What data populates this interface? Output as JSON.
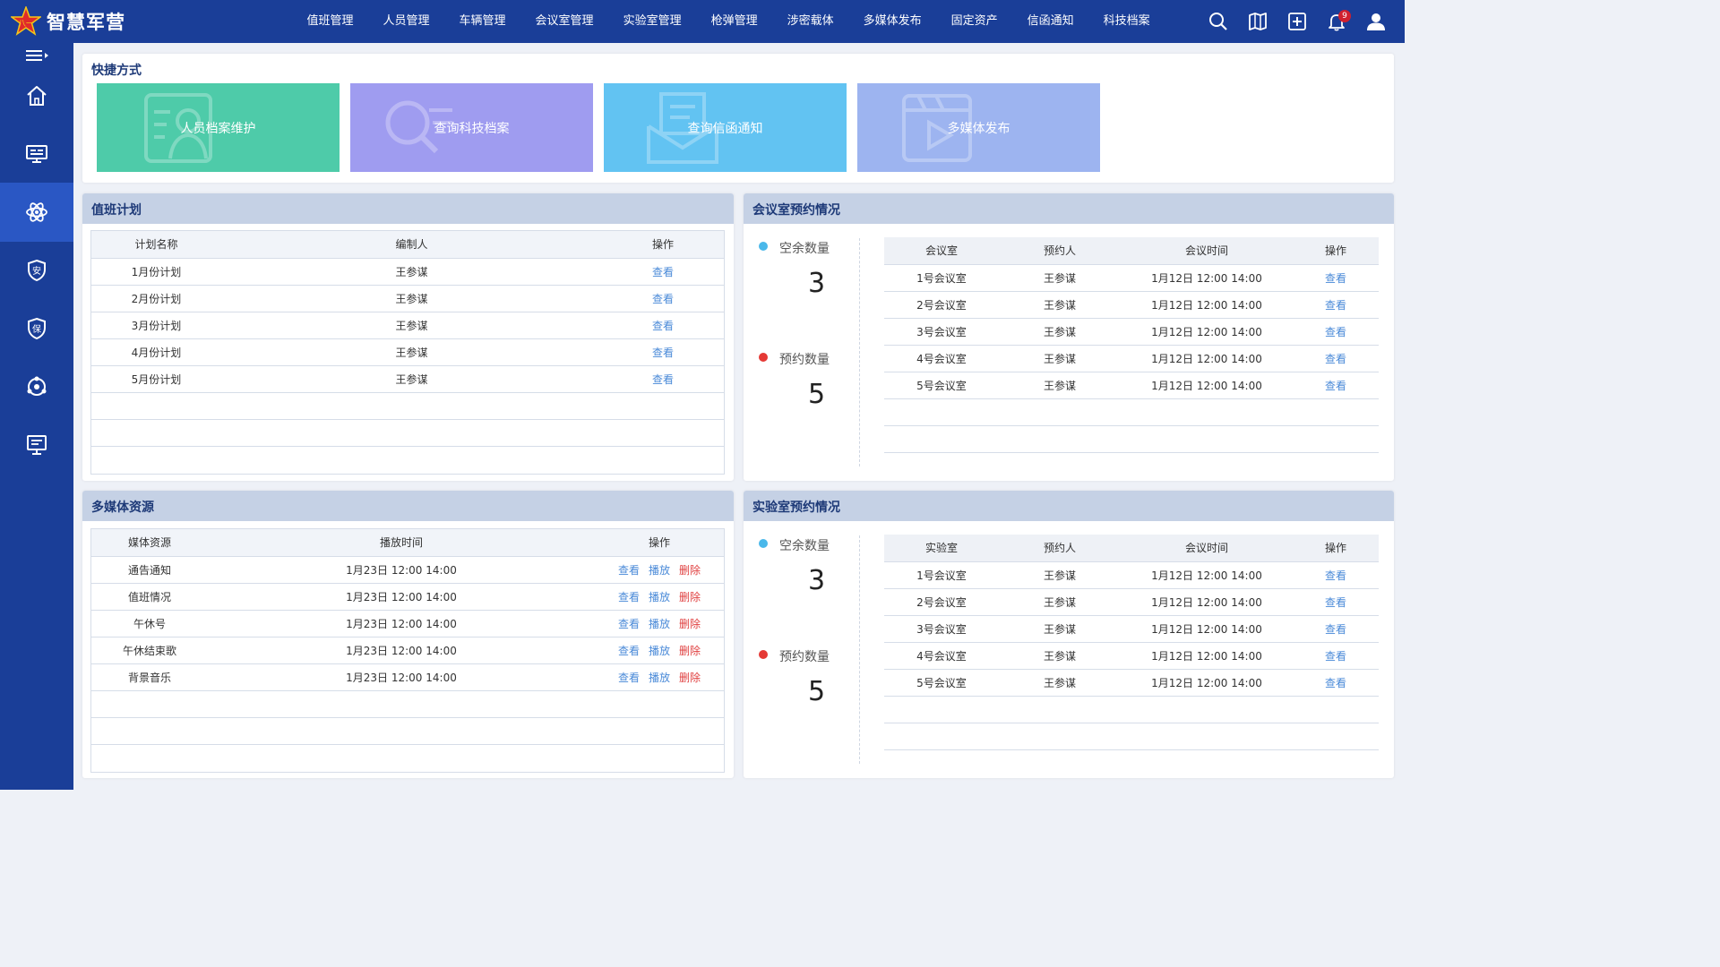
{
  "app": {
    "title": "智慧军营"
  },
  "nav": [
    "值班管理",
    "人员管理",
    "车辆管理",
    "会议室管理",
    "实验室管理",
    "枪弹管理",
    "涉密载体",
    "多媒体发布",
    "固定资产",
    "信函通知",
    "科技档案"
  ],
  "top_icons": {
    "search": "search-icon",
    "map": "map-icon",
    "add": "add-square-icon",
    "bell": "bell-icon",
    "user": "user-icon",
    "bell_badge": "9"
  },
  "sidebar": [
    "home-icon",
    "monitor-icon",
    "atom-icon",
    "shield-an-icon",
    "shield-bao-icon",
    "network-icon",
    "presentation-icon"
  ],
  "quick": {
    "title": "快捷方式",
    "tiles": [
      {
        "label": "人员档案维护",
        "color": "#4ecba9"
      },
      {
        "label": "查询科技档案",
        "color": "#9f9cf0"
      },
      {
        "label": "查询信函通知",
        "color": "#62c3f2"
      },
      {
        "label": "多媒体发布",
        "color": "#9db4f0"
      }
    ]
  },
  "duty": {
    "title": "值班计划",
    "headers": [
      "计划名称",
      "编制人",
      "操作"
    ],
    "rows": [
      {
        "name": "1月份计划",
        "author": "王参谋",
        "action": "查看"
      },
      {
        "name": "2月份计划",
        "author": "王参谋",
        "action": "查看"
      },
      {
        "name": "3月份计划",
        "author": "王参谋",
        "action": "查看"
      },
      {
        "name": "4月份计划",
        "author": "王参谋",
        "action": "查看"
      },
      {
        "name": "5月份计划",
        "author": "王参谋",
        "action": "查看"
      }
    ]
  },
  "meeting": {
    "title": "会议室预约情况",
    "free_label": "空余数量",
    "free_value": "3",
    "booked_label": "预约数量",
    "booked_value": "5",
    "headers": [
      "会议室",
      "预约人",
      "会议时间",
      "操作"
    ],
    "rows": [
      {
        "room": "1号会议室",
        "person": "王参谋",
        "time": "1月12日 12:00 14:00",
        "action": "查看"
      },
      {
        "room": "2号会议室",
        "person": "王参谋",
        "time": "1月12日 12:00 14:00",
        "action": "查看"
      },
      {
        "room": "3号会议室",
        "person": "王参谋",
        "time": "1月12日 12:00 14:00",
        "action": "查看"
      },
      {
        "room": "4号会议室",
        "person": "王参谋",
        "time": "1月12日 12:00 14:00",
        "action": "查看"
      },
      {
        "room": "5号会议室",
        "person": "王参谋",
        "time": "1月12日 12:00 14:00",
        "action": "查看"
      }
    ]
  },
  "media": {
    "title": "多媒体资源",
    "headers": [
      "媒体资源",
      "播放时间",
      "操作"
    ],
    "actions": {
      "view": "查看",
      "play": "播放",
      "delete": "删除"
    },
    "rows": [
      {
        "name": "通告通知",
        "time": "1月23日 12:00  14:00"
      },
      {
        "name": "值班情况",
        "time": "1月23日 12:00  14:00"
      },
      {
        "name": "午休号",
        "time": "1月23日 12:00  14:00"
      },
      {
        "name": "午休结束歌",
        "time": "1月23日 12:00  14:00"
      },
      {
        "name": "背景音乐",
        "time": "1月23日 12:00  14:00"
      }
    ]
  },
  "lab": {
    "title": "实验室预约情况",
    "free_label": "空余数量",
    "free_value": "3",
    "booked_label": "预约数量",
    "booked_value": "5",
    "headers": [
      "实验室",
      "预约人",
      "会议时间",
      "操作"
    ],
    "rows": [
      {
        "room": "1号会议室",
        "person": "王参谋",
        "time": "1月12日 12:00 14:00",
        "action": "查看"
      },
      {
        "room": "2号会议室",
        "person": "王参谋",
        "time": "1月12日 12:00 14:00",
        "action": "查看"
      },
      {
        "room": "3号会议室",
        "person": "王参谋",
        "time": "1月12日 12:00 14:00",
        "action": "查看"
      },
      {
        "room": "4号会议室",
        "person": "王参谋",
        "time": "1月12日 12:00 14:00",
        "action": "查看"
      },
      {
        "room": "5号会议室",
        "person": "王参谋",
        "time": "1月12日 12:00 14:00",
        "action": "查看"
      }
    ]
  },
  "colors": {
    "primary": "#1a3e98",
    "active": "#2a57c4",
    "free_dot": "#4ab8ea",
    "booked_dot": "#e53935",
    "link": "#4a8ad8",
    "danger": "#e04040"
  }
}
